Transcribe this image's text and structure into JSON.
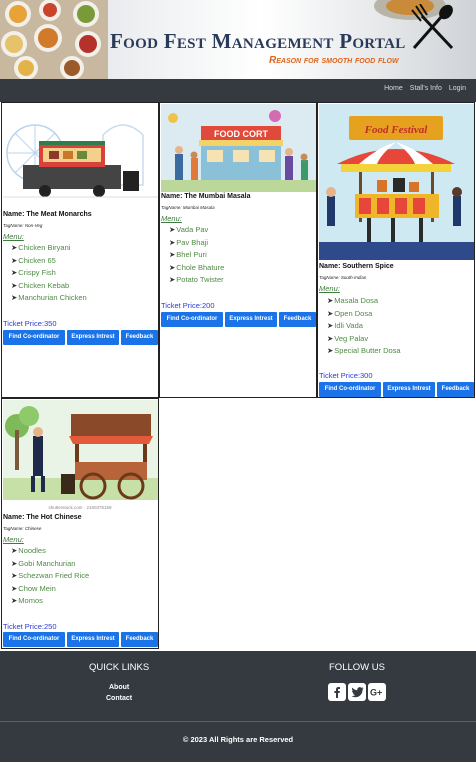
{
  "header": {
    "title": "Food Fest Management Portal",
    "subtitle": "Reason for smooth food flow"
  },
  "nav": {
    "home": "Home",
    "stalls_info": "Stall's Info",
    "login": "Login"
  },
  "buttons": {
    "coordinator": "Find Co-ordinator",
    "interest": "Express Intrest",
    "feedback": "Feedback"
  },
  "menu_heading": "Menu:",
  "stalls": [
    {
      "name": "Name: The Meat Monarchs",
      "tag": "TagName: Non-Veg",
      "items": [
        "Chicken Biryani",
        "Chicken 65",
        "Crispy Fish",
        "Chicken Kebab",
        "Manchurian Chicken"
      ],
      "price": "Ticket Price:350"
    },
    {
      "name": "Name: The Mumbai Masala",
      "tag": "TagName: Mumbai Masala",
      "items": [
        "Vada Pav",
        "Pav Bhaji",
        "Bhel Puri",
        "Chole Bhature",
        "Potato Twister"
      ],
      "price": "Ticket Price:200",
      "image_text": "FOOD CORT"
    },
    {
      "name": "Name: Southern Spice",
      "tag": "TagName: South-Indian",
      "items": [
        "Masala Dosa",
        "Open Dosa",
        "Idli Vada",
        "Veg Palav",
        "Special Butter Dosa"
      ],
      "price": "Ticket Price:300",
      "image_text": "Food Festival"
    },
    {
      "name": "Name: The Hot Chinese",
      "tag": "TagName: Chinese",
      "items": [
        "Noodles",
        "Gobi Manchurian",
        "Schezwan Fried Rice",
        "Chow Mein",
        "Momos"
      ],
      "price": "Ticket Price:250",
      "image_text": "shutterstock.com · 2160375159"
    }
  ],
  "footer": {
    "quick_links_heading": "QUICK LINKS",
    "about": "About",
    "contact": "Contact",
    "follow_heading": "FOLLOW US",
    "social_icons": [
      "facebook-icon",
      "twitter-icon",
      "google-plus-icon"
    ],
    "copyright": "© 2023 All Rights are Reserved"
  },
  "colors": {
    "navbar": "#343a40",
    "button": "#1a73e8",
    "menu_item": "#4f8a45",
    "price": "#2a3ad8",
    "subtitle": "#e0621a"
  }
}
